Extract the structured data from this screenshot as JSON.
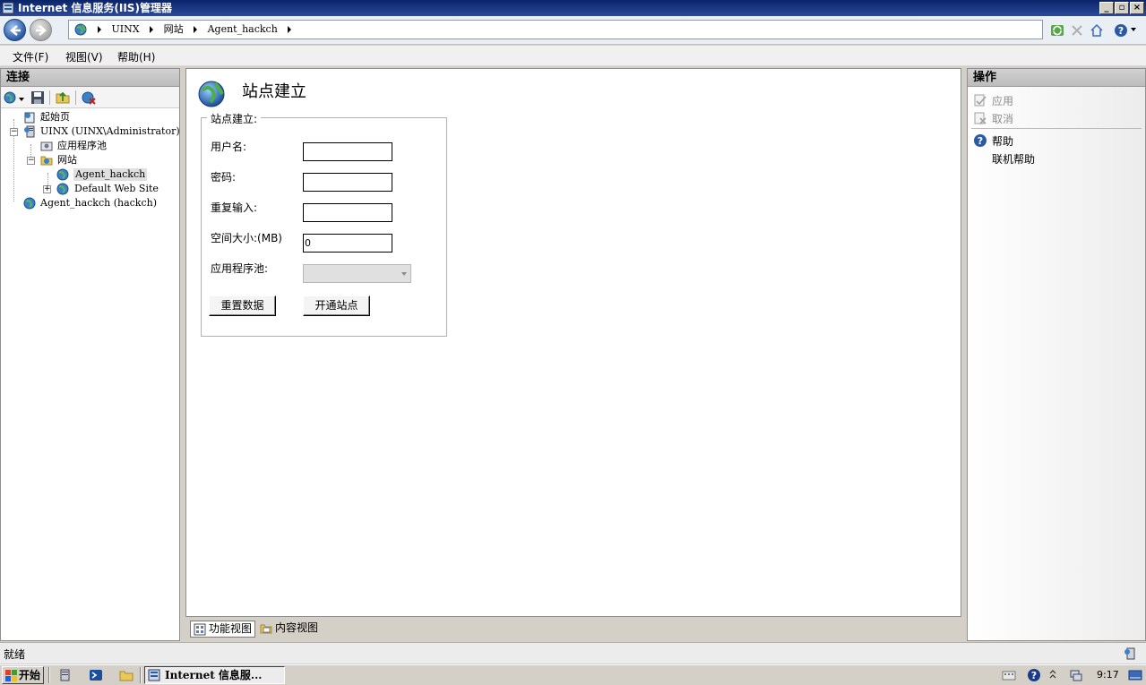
{
  "window": {
    "title": "Internet 信息服务(IIS)管理器"
  },
  "address": {
    "crumbs": [
      "UINX",
      "网站",
      "Agent_hackch"
    ]
  },
  "menu": [
    "文件(F)",
    "视图(V)",
    "帮助(H)"
  ],
  "connections": {
    "header": "连接",
    "tree": {
      "start_page": "起始页",
      "server": "UINX (UINX\\Administrator)",
      "app_pools": "应用程序池",
      "sites": "网站",
      "site_agent": "Agent_hackch",
      "site_default": "Default Web Site",
      "agent_conn": "Agent_hackch (hackch)"
    }
  },
  "main": {
    "title": "站点建立",
    "group_label": "站点建立:",
    "fields": {
      "username_label": "用户名:",
      "password_label": "密码:",
      "repeat_label": "重复输入:",
      "space_label": "空间大小:(MB)",
      "space_value": "0",
      "pool_label": "应用程序池:"
    },
    "buttons": {
      "reset": "重置数据",
      "open": "开通站点"
    },
    "view_tabs": [
      "功能视图",
      "内容视图"
    ]
  },
  "actions": {
    "header": "操作",
    "apply": "应用",
    "cancel": "取消",
    "help": "帮助",
    "online_help": "联机帮助"
  },
  "status": {
    "text": "就绪"
  },
  "taskbar": {
    "start": "开始",
    "task_label": "Internet 信息服...",
    "time": "9:17"
  },
  "colors": {
    "titlebar": "#0a246a",
    "panel_header": "#c8c8c8",
    "disabled_text": "#8c8c8c"
  }
}
